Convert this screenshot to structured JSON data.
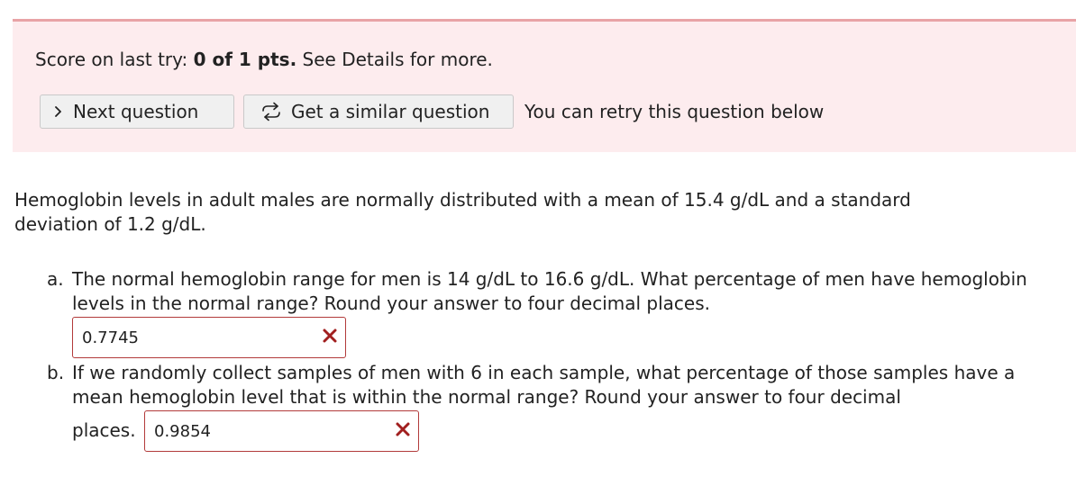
{
  "banner": {
    "score_prefix": "Score on last try: ",
    "score_value": "0 of 1 pts.",
    "score_suffix": " See Details for more.",
    "next_button_label": "Next question",
    "similar_button_label": "Get a similar question",
    "retry_text": "You can retry this question below"
  },
  "question": {
    "intro": "Hemoglobin levels in adult males are normally distributed with a mean of 15.4 g/dL and a standard deviation of 1.2 g/dL.",
    "part_a": {
      "letter": "a.",
      "text": "The normal hemoglobin range for men is 14 g/dL to 16.6 g/dL. What percentage of men have hemoglobin levels in the normal range? Round your answer to four decimal places.",
      "answer": "0.7745"
    },
    "part_b": {
      "letter": "b.",
      "text": "If we randomly collect samples of men with 6 in each sample, what percentage of those samples have a mean hemoglobin level that is within the normal range? Round your answer to four decimal",
      "text_tail": "places.",
      "answer": "0.9854"
    }
  },
  "colors": {
    "banner_bg": "#fdecee",
    "banner_border": "#e8a3a6",
    "incorrect": "#b23a3a",
    "x_mark": "#a11f1f"
  },
  "icons": {
    "next": "chevron-right-icon",
    "similar": "refresh-arrows-icon",
    "incorrect": "x-mark-icon"
  }
}
